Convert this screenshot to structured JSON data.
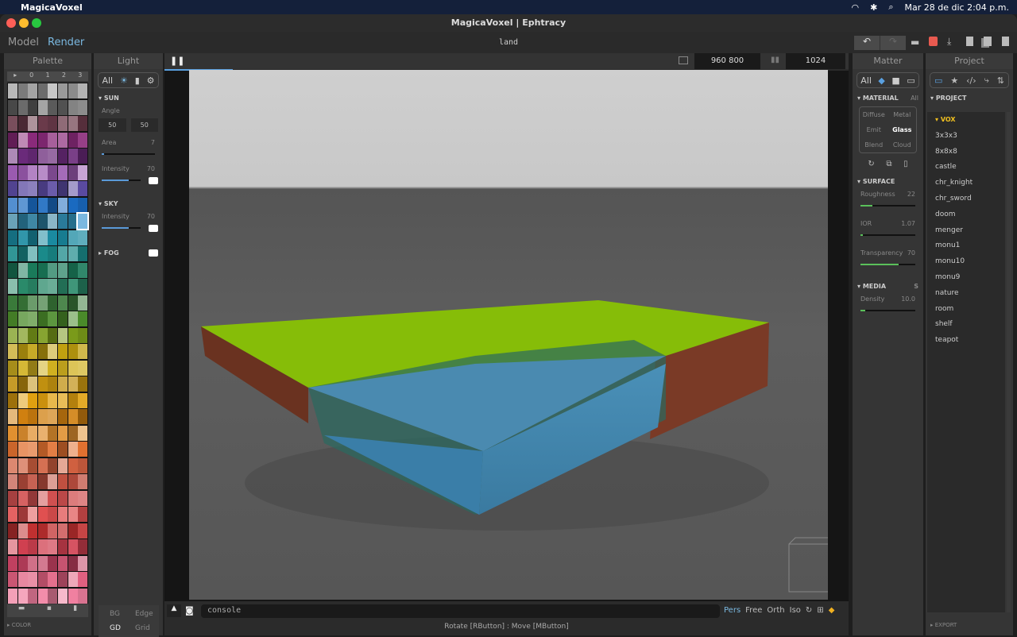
{
  "menubar": {
    "app": "MagicaVoxel",
    "clock": "Mar 28 de dic  2:04 p.m."
  },
  "window": {
    "title": "MagicaVoxel | Ephtracy"
  },
  "toolbar": {
    "mode_model": "Model",
    "mode_render": "Render",
    "file_name": "land"
  },
  "palette": {
    "title": "Palette",
    "pages": [
      "▸",
      "0",
      "1",
      "2",
      "3"
    ],
    "footer": "COLOR",
    "row_colors": [
      "#9a9a9a",
      "#5a5a5a",
      "#6a3a4a",
      "#8a2a7a",
      "#6a2a7a",
      "#9a5ab0",
      "#5a4aa0",
      "#1a6ac0",
      "#2a7a9a",
      "#1a8aa0",
      "#1a8a8a",
      "#1a7a5a",
      "#2a8a6a",
      "#3a7a3a",
      "#4a8a2a",
      "#7a9a1a",
      "#c0a010",
      "#d0b020",
      "#c09010",
      "#e0a010",
      "#d08010",
      "#e09030",
      "#e07030",
      "#d06040",
      "#c05040",
      "#d05050",
      "#e05050",
      "#c03030",
      "#d04050",
      "#c04060",
      "#e06080",
      "#f080a0"
    ],
    "accent": "#7ab8e0"
  },
  "light": {
    "title": "Light",
    "filters": [
      "All",
      "☀",
      "▮",
      "⚙"
    ],
    "sun": "SUN",
    "angle_label": "Angle",
    "angle": [
      "50",
      "50"
    ],
    "area_label": "Area",
    "area": "7",
    "intensity_label": "Intensity",
    "intensity": "70",
    "sky": "SKY",
    "sky_intensity_label": "Intensity",
    "sky_intensity": "70",
    "fog": "FOG",
    "area_level": 0.05,
    "intensity_level": 0.7
  },
  "viewport": {
    "size": "960  800",
    "samples": "1024",
    "progress": 0.1,
    "console_placeholder": "console",
    "views": [
      "Pers",
      "Free",
      "Orth",
      "Iso"
    ],
    "status": "Rotate [RButton] : Move [MButton]",
    "bg": "BG",
    "edge": "Edge",
    "gd": "GD",
    "grid": "Grid"
  },
  "matter": {
    "title": "Matter",
    "filters": [
      "All",
      "◆",
      "■",
      "▭"
    ],
    "material": "MATERIAL",
    "material_all": "All",
    "types": [
      "Diffuse",
      "Metal",
      "Emit",
      "Glass",
      "Blend",
      "Cloud"
    ],
    "selected": "Glass",
    "surface": "SURFACE",
    "roughness_label": "Roughness",
    "roughness": "22",
    "ior_label": "IOR",
    "ior": "1.07",
    "transparency_label": "Transparency",
    "transparency": "70",
    "media": "MEDIA",
    "media_s": "S",
    "density_label": "Density",
    "density": "10.0",
    "roughness_level": 0.22,
    "ior_level": 0.03,
    "transparency_level": 0.7,
    "density_level": 0.08
  },
  "project": {
    "title": "Project",
    "section": "PROJECT",
    "folder": "VOX",
    "items": [
      "3x3x3",
      "8x8x8",
      "castle",
      "chr_knight",
      "chr_sword",
      "doom",
      "menger",
      "monu1",
      "monu10",
      "monu9",
      "nature",
      "room",
      "shelf",
      "teapot"
    ],
    "export": "EXPORT"
  }
}
